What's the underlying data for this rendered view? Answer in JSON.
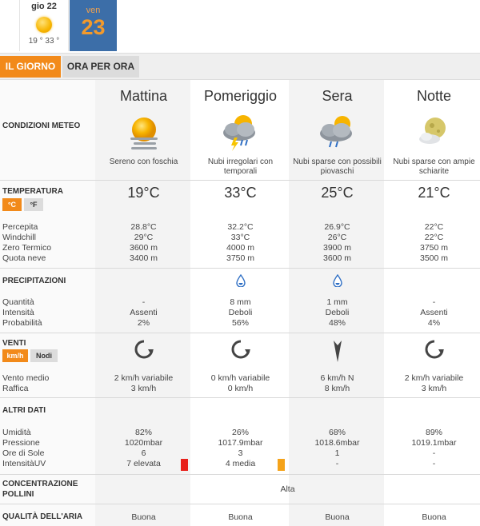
{
  "days": [
    {
      "label": "gio 22",
      "temps": "19 ° 33 °",
      "icon": "sun-icon"
    },
    {
      "label": "ven",
      "number": "23"
    }
  ],
  "tabs": {
    "day": "IL GIORNO",
    "hour": "ORA PER ORA"
  },
  "periods": [
    "Mattina",
    "Pomeriggio",
    "Sera",
    "Notte"
  ],
  "sections": {
    "conditions": "CONDIZIONI METEO",
    "temperature": "TEMPERATURA",
    "precip": "PRECIPITAZIONI",
    "wind": "VENTI",
    "other": "ALTRI DATI",
    "pollen": "CONCENTRAZIONE POLLINI",
    "air": "QUALITÀ DELL'ARIA"
  },
  "units": {
    "celsius": "°C",
    "fahrenheit": "°F",
    "kmh": "km/h",
    "knots": "Nodi"
  },
  "conditions": [
    {
      "icon": "sun-haze-icon",
      "text": "Sereno con foschia"
    },
    {
      "icon": "storm-cloud-icon",
      "text": "Nubi irregolari con temporali"
    },
    {
      "icon": "rain-cloud-icon",
      "text": "Nubi sparse con possibili piovaschi"
    },
    {
      "icon": "moon-cloud-icon",
      "text": "Nubi sparse con ampie schiarite"
    }
  ],
  "temps": [
    "19°C",
    "33°C",
    "25°C",
    "21°C"
  ],
  "temp_rows": {
    "labels": [
      "Percepita",
      "Windchill",
      "Zero Termico",
      "Quota neve"
    ],
    "values": [
      [
        "28.8°C",
        "29°C",
        "3600 m",
        "3400 m"
      ],
      [
        "32.2°C",
        "33°C",
        "4000 m",
        "3750 m"
      ],
      [
        "26.9°C",
        "26°C",
        "3900 m",
        "3600 m"
      ],
      [
        "22°C",
        "22°C",
        "3750 m",
        "3500 m"
      ]
    ]
  },
  "precip_rows": {
    "labels": [
      "Quantità",
      "Intensità",
      "Probabilità"
    ],
    "values": [
      [
        "-",
        "Assenti",
        "2%"
      ],
      [
        "8 mm",
        "Deboli",
        "56%"
      ],
      [
        "1 mm",
        "Deboli",
        "48%"
      ],
      [
        "-",
        "Assenti",
        "4%"
      ]
    ]
  },
  "wind_rows": {
    "labels": [
      "Vento medio",
      "Raffica"
    ],
    "values": [
      [
        "2 km/h variabile",
        "3 km/h"
      ],
      [
        "0 km/h variabile",
        "0 km/h"
      ],
      [
        "6 km/h N",
        "8 km/h"
      ],
      [
        "2 km/h variabile",
        "3 km/h"
      ]
    ]
  },
  "other_rows": {
    "labels": [
      "Umidità",
      "Pressione",
      "Ore di Sole",
      "IntensitàUV"
    ],
    "values": [
      [
        "82%",
        "1020mbar",
        "6",
        "7 elevata"
      ],
      [
        "26%",
        "1017.9mbar",
        "3",
        "4 media"
      ],
      [
        "68%",
        "1018.6mbar",
        "1",
        "-"
      ],
      [
        "89%",
        "1019.1mbar",
        "-",
        "-"
      ]
    ]
  },
  "uv_colors": [
    "#e8201a",
    "#f5a31a"
  ],
  "pollen": "Alta",
  "air": [
    "Buona",
    "Buona",
    "Buona",
    "Buona"
  ]
}
